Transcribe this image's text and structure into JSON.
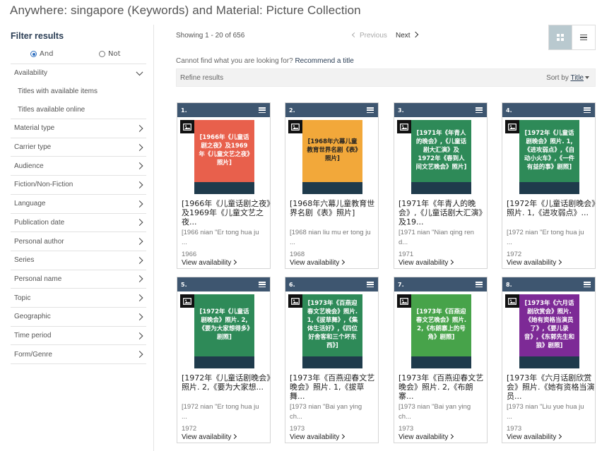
{
  "page_title": "Anywhere: singapore (Keywords) and Material: Picture Collection",
  "sidebar": {
    "title": "Filter results",
    "and_label": "And",
    "not_label": "Not",
    "availability": {
      "label": "Availability",
      "options": [
        "Titles with available items",
        "Titles available online"
      ]
    },
    "facets": [
      "Material type",
      "Carrier type",
      "Audience",
      "Fiction/Non-Fiction",
      "Language",
      "Publication date",
      "Personal author",
      "Series",
      "Personal name",
      "Topic",
      "Geographic",
      "Time period",
      "Form/Genre"
    ]
  },
  "results": {
    "showing": "Showing 1 - 20 of 656",
    "previous": "Previous",
    "next": "Next",
    "cannot_find": "Cannot find what you are looking for?",
    "recommend": "Recommend a title",
    "refine": "Refine results",
    "sort_label": "Sort by",
    "sort_value": "Title"
  },
  "cards": [
    {
      "num": "1.",
      "cover_color": "#e8604c",
      "cover_text": "[1966年《儿童话剧之夜》及1969年《儿童文艺之夜》照片]",
      "title": "[1966年《儿童话剧之夜》及1969年《儿童文艺之夜...",
      "romaji": "[1966 nian \"Er tong hua ju ...",
      "year": "1966",
      "avail": "View availability"
    },
    {
      "num": "2.",
      "cover_color": "#f2a83a",
      "cover_text": "[1968年六幕儿童教育世界名剧《表》照片]",
      "title": "[1968年六幕儿童教育世界名剧《表》照片]",
      "romaji": "[1968 nian liu mu er tong ju ...",
      "year": "1968",
      "avail": "View availability"
    },
    {
      "num": "3.",
      "cover_color": "#2e8a58",
      "cover_text": "[1971年《年青人的晚会》,《儿童话剧大汇演》及1972年《春到人间文艺晚会》照片]",
      "title": "[1971年《年青人的晚会》,《儿童话剧大汇演》及19...",
      "romaji": "[1971 nian \"Nian qing ren d...",
      "year": "1971",
      "avail": "View availability"
    },
    {
      "num": "4.",
      "cover_color": "#2e8a58",
      "cover_text": "[1972年《儿童话剧晚会》照片. 1,《进攻弱点》,《自动小火车》,《一件有益的事》剧照]",
      "title": "[1972年《儿童话剧晚会》照片. 1,《进攻弱点》...",
      "romaji": "[1972 nian \"Er tong hua ju ...",
      "year": "1972",
      "avail": "View availability"
    },
    {
      "num": "5.",
      "cover_color": "#2e8a58",
      "cover_text": "[1972年《儿童话剧晚会》照片. 2,《要为大家想得多》剧照]",
      "title": "[1972年《儿童话剧晚会》照片. 2,《要为大家想...",
      "romaji": "[1972 nian \"Er tong hua ju ...",
      "year": "1972",
      "avail": "View availability"
    },
    {
      "num": "6.",
      "cover_color": "#2e8a58",
      "cover_text": "[1973年《百燕迎春文艺晚会》照片. 1,《拔草舞》,《集体生活好》,《四位好舍客和三个坏东西》]",
      "title": "[1973年《百燕迎春文艺晚会》照片. 1,《拔草舞...",
      "romaji": "[1973 nian \"Bai yan ying ch...",
      "year": "1973",
      "avail": "View availability"
    },
    {
      "num": "7.",
      "cover_color": "#47a34a",
      "cover_text": "[1973年《百燕迎春文艺晚会》照片. 2,《布朗寨上的号角》剧照]",
      "title": "[1973年《百燕迎春文艺晚会》照片. 2,《布朗寨...",
      "romaji": "[1973 nian \"Bai yan ying ch...",
      "year": "1973",
      "avail": "View availability"
    },
    {
      "num": "8.",
      "cover_color": "#7d2a96",
      "cover_text": "[1973年《六月话剧欣赏会》照片.《她有资格当演员了》,《要儿录音》,《东郭先生和狼》剧照]",
      "title": "[1973年《六月话剧欣赏会》照片.《她有资格当演员...",
      "romaji": "[1973 nian \"Liu yue hua ju ...",
      "year": "1973",
      "avail": "View availability"
    }
  ]
}
